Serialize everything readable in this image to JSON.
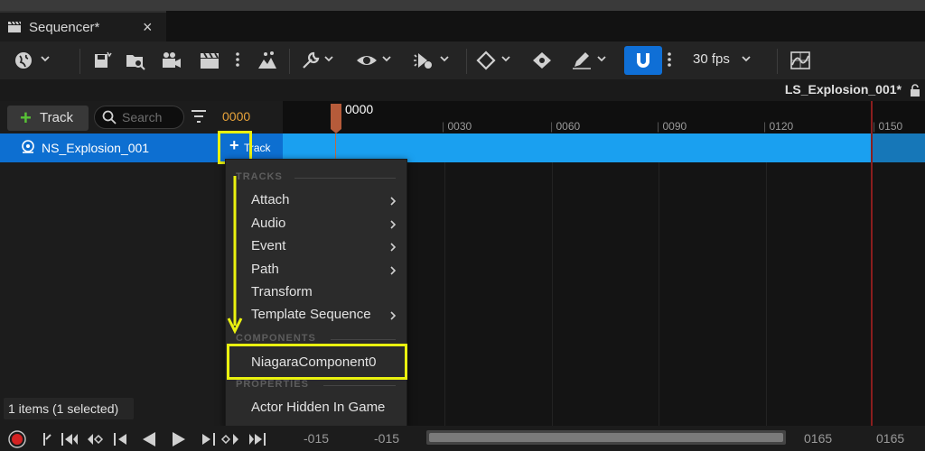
{
  "tab": {
    "title": "Sequencer*",
    "close": "×"
  },
  "toolbar": {
    "fps": "30 fps",
    "icons": [
      "globe-icon",
      "save-icon",
      "browse-icon",
      "camera-icon",
      "clapperboard-icon",
      "render-icon",
      "wrench-icon",
      "eye-icon",
      "playback-icon",
      "key-icon",
      "keyframe-icon",
      "pencil-icon",
      "magnet-icon",
      "curve-editor-icon"
    ]
  },
  "sequence": {
    "title": "LS_Explosion_001*"
  },
  "left_panel": {
    "track_button": "Track",
    "search_placeholder": "Search",
    "current_frame": "0000",
    "row": {
      "label": "NS_Explosion_001",
      "add_track": "Track"
    }
  },
  "timeline": {
    "playhead": "0000",
    "ticks": [
      "0030",
      "0060",
      "0090",
      "0120",
      "0150"
    ]
  },
  "menu": {
    "sections": [
      {
        "heading": "TRACKS",
        "items": [
          {
            "label": "Attach",
            "submenu": true
          },
          {
            "label": "Audio",
            "submenu": true
          },
          {
            "label": "Event",
            "submenu": true
          },
          {
            "label": "Path",
            "submenu": true
          },
          {
            "label": "Transform",
            "submenu": false
          },
          {
            "label": "Template Sequence",
            "submenu": true
          }
        ]
      },
      {
        "heading": "COMPONENTS",
        "items": [
          {
            "label": "NiagaraComponent0",
            "submenu": false
          }
        ]
      },
      {
        "heading": "PROPERTIES",
        "items": [
          {
            "label": "Actor Hidden In Game",
            "submenu": false
          }
        ]
      }
    ]
  },
  "status": "1 items (1 selected)",
  "bottom": {
    "start_out": "-015",
    "start_in": "-015",
    "end_in": "0165",
    "end_out": "0165"
  },
  "colors": {
    "accent": "#0d6fd1",
    "highlight": "#eaf20f",
    "frame": "#e8a33a",
    "add": "#58c236",
    "track_bar": "#1aa0f0"
  }
}
